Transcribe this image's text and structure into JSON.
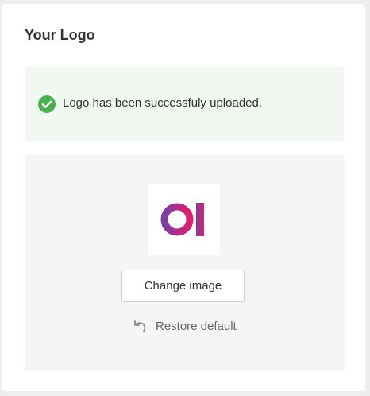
{
  "card": {
    "title": "Your Logo"
  },
  "alert": {
    "icon": "check-circle-icon",
    "message": "Logo has been successfuly uploaded.",
    "color": "#4caf50"
  },
  "upload": {
    "logo_icon": "brand-logo",
    "logo_gradient": [
      "#7b3fa0",
      "#e01e6e"
    ],
    "change_label": "Change image",
    "restore_icon": "undo-icon",
    "restore_label": "Restore default"
  }
}
